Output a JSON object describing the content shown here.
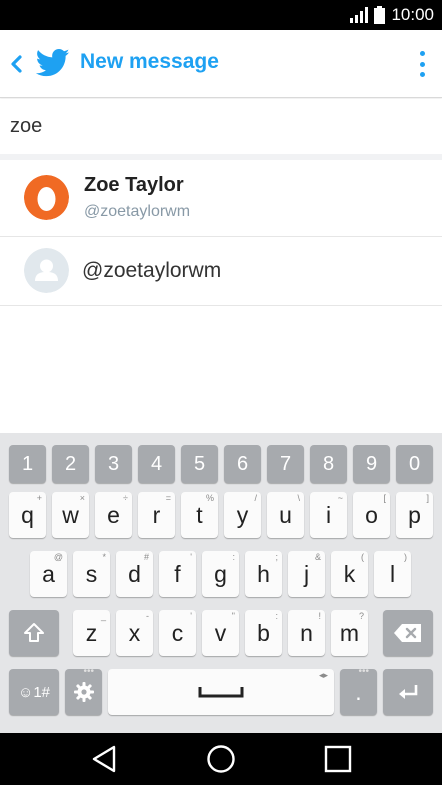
{
  "status": {
    "time": "10:00"
  },
  "appbar": {
    "title": "New message"
  },
  "search": {
    "value": "zoe"
  },
  "results": [
    {
      "name": "Zoe Taylor",
      "handle": "@zoetaylorwm"
    },
    {
      "handle": "@zoetaylorwm"
    }
  ],
  "keyboard": {
    "numbers": [
      "1",
      "2",
      "3",
      "4",
      "5",
      "6",
      "7",
      "8",
      "9",
      "0"
    ],
    "row1": [
      {
        "key": "q",
        "sub": "+"
      },
      {
        "key": "w",
        "sub": "×"
      },
      {
        "key": "e",
        "sub": "÷"
      },
      {
        "key": "r",
        "sub": "="
      },
      {
        "key": "t",
        "sub": "%"
      },
      {
        "key": "y",
        "sub": "/"
      },
      {
        "key": "u",
        "sub": "\\"
      },
      {
        "key": "i",
        "sub": "~"
      },
      {
        "key": "o",
        "sub": "["
      },
      {
        "key": "p",
        "sub": "]"
      }
    ],
    "row2": [
      {
        "key": "a",
        "sub": "@"
      },
      {
        "key": "s",
        "sub": "*"
      },
      {
        "key": "d",
        "sub": "#"
      },
      {
        "key": "f",
        "sub": "'"
      },
      {
        "key": "g",
        "sub": ":"
      },
      {
        "key": "h",
        "sub": ";"
      },
      {
        "key": "j",
        "sub": "&"
      },
      {
        "key": "k",
        "sub": "("
      },
      {
        "key": "l",
        "sub": ")"
      }
    ],
    "row3": [
      {
        "key": "z",
        "sub": "_"
      },
      {
        "key": "x",
        "sub": "-"
      },
      {
        "key": "c",
        "sub": "'"
      },
      {
        "key": "v",
        "sub": "\""
      },
      {
        "key": "b",
        "sub": ":"
      },
      {
        "key": "n",
        "sub": "!"
      },
      {
        "key": "m",
        "sub": "?"
      }
    ],
    "emoji_label": "☺1#",
    "period_label": ".",
    "accent_color": "#1ea1f2"
  }
}
